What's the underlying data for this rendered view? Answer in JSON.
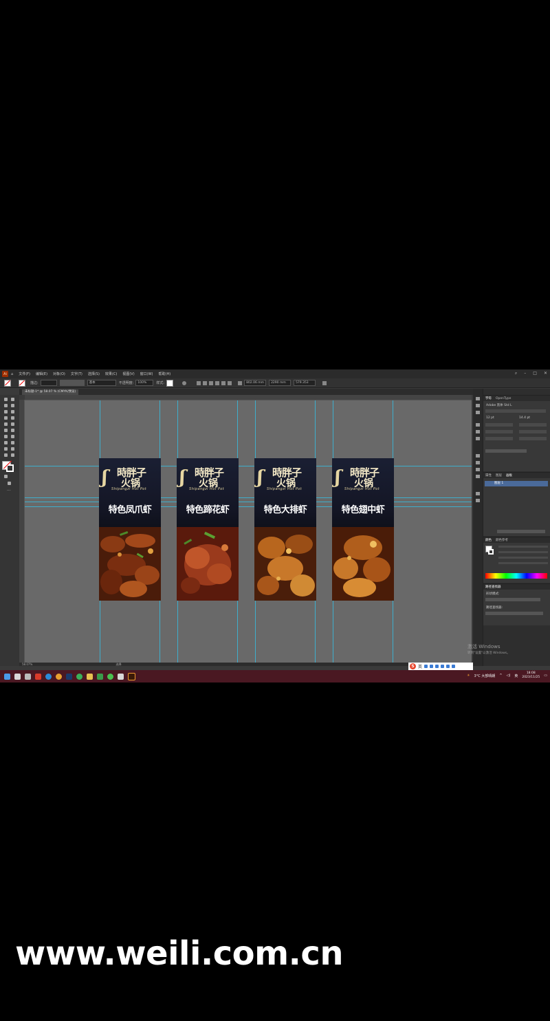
{
  "app": {
    "logo": "Ai",
    "menu": [
      "文件(F)",
      "编辑(E)",
      "对象(O)",
      "文字(T)",
      "选择(S)",
      "效果(C)",
      "视图(V)",
      "窗口(W)",
      "帮助(H)"
    ],
    "document_tab": "未标题-1* @ 58.07 % (CMYK/预览)",
    "zoom_status": "58.07%",
    "status_text": "选择",
    "control_bar": {
      "stroke_label": "描边:",
      "uniform_label": "基本",
      "opacity_label": "不透明度:",
      "opacity_value": "100%",
      "style_label": "样式:",
      "x_value": "802.06 mm",
      "y_value": "2290 mm",
      "w_value": "579.353"
    }
  },
  "banners": [
    {
      "brand": "時胖子",
      "brand2": "火锅",
      "brand_en": "Shipangzi  Hot Pot",
      "dish": "特色凤爪虾"
    },
    {
      "brand": "時胖子",
      "brand2": "火锅",
      "brand_en": "Shipangzi  Hot Pot",
      "dish": "特色蹄花虾"
    },
    {
      "brand": "時胖子",
      "brand2": "火锅",
      "brand_en": "Shipangzi  Hot Pot",
      "dish": "特色大排虾"
    },
    {
      "brand": "時胖子",
      "brand2": "火锅",
      "brand_en": "Shipangzi  Hot Pot",
      "dish": "特色翅中虾"
    }
  ],
  "panels": {
    "character": {
      "tabs": [
        "字符",
        "OpenType"
      ],
      "font": "Adobe 黑体 Std L",
      "size": "12 pt",
      "leading": "14.4 pt"
    },
    "layers": {
      "tabs": [
        "属性",
        "图层",
        "画板"
      ],
      "layer_name": "图层 1"
    },
    "color": {
      "tabs": [
        "颜色",
        "颜色参考"
      ]
    },
    "pathfinder": {
      "tabs": [
        "路径查找器"
      ],
      "shape_modes": "形状模式:",
      "pathfinders": "路径查找器:"
    }
  },
  "activate_windows": {
    "title": "激活 Windows",
    "subtitle": "转到\"设置\"以激活 Windows。"
  },
  "taskbar": {
    "weather": "3°C  大部晴朗",
    "time": "18:08",
    "date": "2023/11/25",
    "lang": "英"
  },
  "watermark": "www.weili.com.cn",
  "colors": {
    "guide": "#33c0e6",
    "taskbar": "#4a1822",
    "canvas": "#696969"
  }
}
